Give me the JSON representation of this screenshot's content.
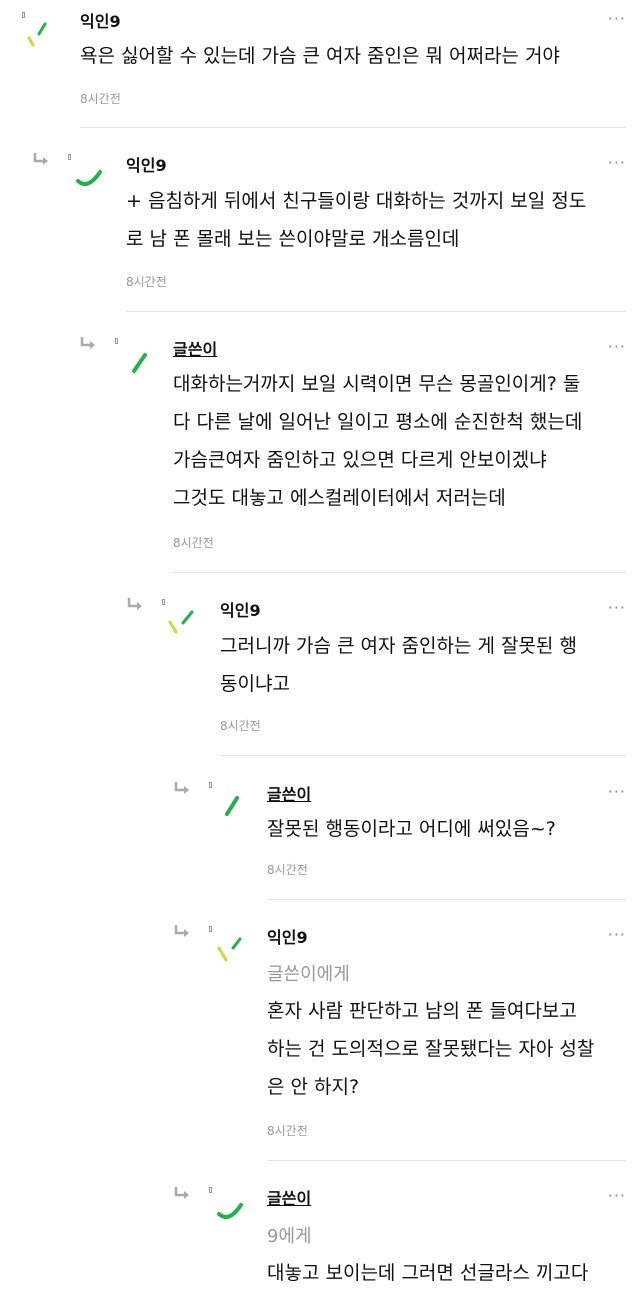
{
  "ui": {
    "more_glyph": "···",
    "accent_green": "#22b24c",
    "accent_lime": "#c9d938"
  },
  "comments": [
    {
      "author": "익인9",
      "lines": [
        "욕은 싫어할 수 있는데 가슴 큰 여자 줌인은 뭐 어쩌라는 거야"
      ],
      "time": "8시간전"
    },
    {
      "author": "익인9",
      "lines": [
        "+ 음침하게 뒤에서 친구들이랑 대화하는 것까지 보일 정도",
        "로 남 폰 몰래 보는 쓴이야말로 개소름인데"
      ],
      "time": "8시간전"
    },
    {
      "author": "글쓴이",
      "lines": [
        "대화하는거까지 보일 시력이면 무슨 몽골인이게? 둘",
        "다 다른 날에 일어난 일이고 평소에 순진한척 했는데",
        "가슴큰여자 줌인하고 있으면 다르게 안보이겠냐",
        "그것도 대놓고 에스컬레이터에서 저러는데"
      ],
      "time": "8시간전"
    },
    {
      "author": "익인9",
      "lines": [
        "그러니까 가슴 큰 여자 줌인하는 게 잘못된 행",
        "동이냐고"
      ],
      "time": "8시간전"
    },
    {
      "author": "글쓴이",
      "lines": [
        "잘못된 행동이라고 어디에 써있음~?"
      ],
      "time": "8시간전"
    },
    {
      "author": "익인9",
      "target": "글쓴이에게",
      "lines": [
        "혼자 사람 판단하고 남의 폰 들여다보고",
        "하는 건 도의적으로 잘못됐다는 자아 성찰",
        "은 안 하지?"
      ],
      "time": "8시간전"
    },
    {
      "author": "글쓴이",
      "target": "9에게",
      "lines": [
        "대놓고 보이는데 그러면 선글라스 끼고다"
      ]
    }
  ]
}
